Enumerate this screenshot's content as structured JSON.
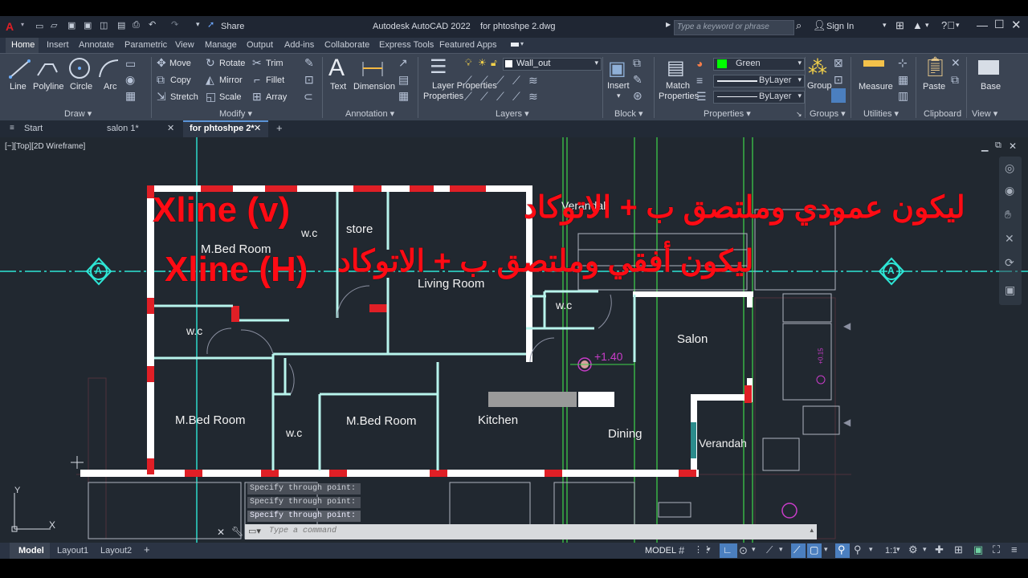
{
  "app": {
    "title": "Autodesk AutoCAD 2022",
    "file": "for phtoshpe 2.dwg",
    "share": "Share",
    "search_placeholder": "Type a keyword or phrase",
    "sign_in": "Sign In"
  },
  "ribbon_tabs": [
    "Home",
    "Insert",
    "Annotate",
    "Parametric",
    "View",
    "Manage",
    "Output",
    "Add-ins",
    "Collaborate",
    "Express Tools",
    "Featured Apps"
  ],
  "ribbon": {
    "draw": {
      "label": "Draw",
      "tools": [
        "Line",
        "Polyline",
        "Circle",
        "Arc"
      ]
    },
    "modify": {
      "label": "Modify",
      "tools": [
        "Move",
        "Rotate",
        "Trim",
        "Copy",
        "Mirror",
        "Fillet",
        "Stretch",
        "Scale",
        "Array"
      ]
    },
    "annotation": {
      "label": "Annotation",
      "tools": [
        "Text",
        "Dimension"
      ]
    },
    "layers": {
      "label": "Layers",
      "layer_props": "Layer Properties",
      "layer_props_line2": "Properties",
      "current_layer": "Wall_out"
    },
    "block": {
      "label": "Block",
      "insert": "Insert"
    },
    "properties": {
      "label": "Properties",
      "match": "Match",
      "match_line2": "Properties",
      "color": "Green",
      "linetype": "ByLayer",
      "lineweight": "ByLayer"
    },
    "groups": {
      "label": "Groups",
      "group": "Group"
    },
    "utilities": {
      "label": "Utilities",
      "measure": "Measure"
    },
    "clipboard": {
      "label": "Clipboard",
      "paste": "Paste"
    },
    "view": {
      "label": "View",
      "base": "Base"
    }
  },
  "file_tabs": [
    "Start",
    "salon 1*",
    "for phtoshpe 2*"
  ],
  "viewport": {
    "label": "[−][Top][2D Wireframe]",
    "rooms": [
      "M.Bed Room",
      "w.c",
      "store",
      "Living Room",
      "Verandah",
      "w.c",
      "w.c",
      "Salon",
      "M.Bed Room",
      "w.c",
      "M.Bed Room",
      "Kitchen",
      "Dining",
      "Verandah"
    ],
    "dimension": "+1.40",
    "small_dim": "+0.15",
    "axis_label": "A",
    "ucs_y": "Y",
    "ucs_x": "X"
  },
  "overlay": {
    "arabic_1": "ليكون عمودي وملتصق ب + الاتوكاد",
    "arabic_2": "ليكون أفقي وملتصق ب + الاتوكاد",
    "xline_v": "Xline (v)",
    "xline_h": "Xline (H)"
  },
  "command": {
    "history": [
      "Specify through point:",
      "Specify through point:",
      "Specify through point:"
    ],
    "placeholder": "Type a command"
  },
  "layout_tabs": [
    "Model",
    "Layout1",
    "Layout2"
  ],
  "status": {
    "mode": "MODEL",
    "scale": "1:1"
  },
  "colors": {
    "accent": "#e01f26",
    "wall_red": "#ff0b14",
    "xline_cyan": "#2ee6d6",
    "xline_green": "#3fd64b",
    "viewport_bg": "#212830"
  }
}
